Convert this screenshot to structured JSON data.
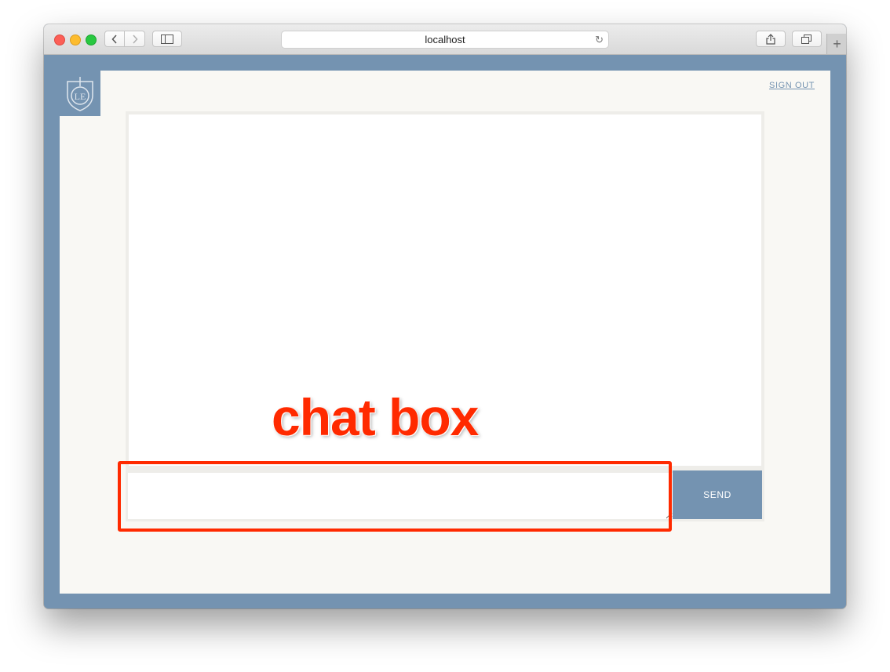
{
  "browser": {
    "url": "localhost",
    "icons": {
      "back": "chevron-left-icon",
      "forward": "chevron-right-icon",
      "sidebar": "sidebar-icon",
      "reload": "reload-icon",
      "share": "share-icon",
      "tabs": "tabs-icon",
      "new_tab": "plus-icon"
    },
    "new_tab_label": "+"
  },
  "app": {
    "sign_out_label": "SIGN OUT",
    "send_label": "SEND",
    "chat_input_value": "",
    "accent_color": "#7493b1",
    "background_color": "#f9f8f4"
  },
  "annotation": {
    "label": "chat box",
    "color": "#ff2a00"
  }
}
